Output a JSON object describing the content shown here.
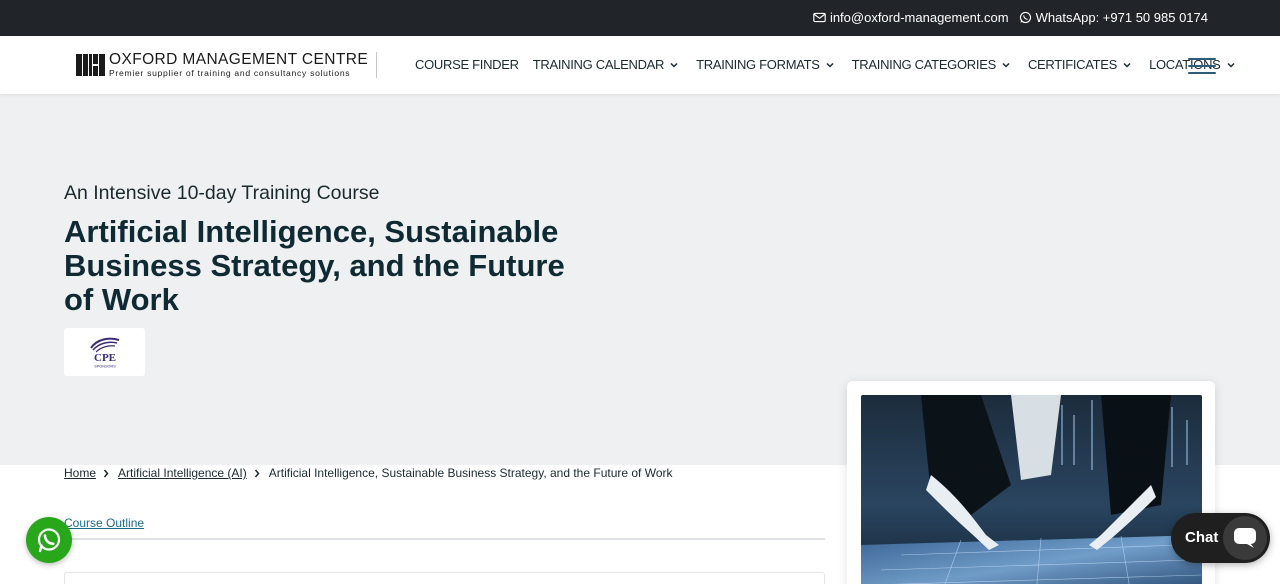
{
  "topbar": {
    "email": "info@oxford-management.com",
    "whatsapp": "WhatsApp: +971 50 985 0174"
  },
  "logo": {
    "name": "OXFORD MANAGEMENT CENTRE",
    "tagline": "Premier supplier of training and consultancy solutions"
  },
  "nav": {
    "items": [
      {
        "label": "COURSE FINDER",
        "has_dropdown": false
      },
      {
        "label": "TRAINING CALENDAR",
        "has_dropdown": true
      },
      {
        "label": "TRAINING FORMATS",
        "has_dropdown": true
      },
      {
        "label": "TRAINING CATEGORIES",
        "has_dropdown": true
      },
      {
        "label": "CERTIFICATES",
        "has_dropdown": true
      },
      {
        "label": "LOCATIONS",
        "has_dropdown": true
      }
    ],
    "menu_icon": "hamburger-icon"
  },
  "hero": {
    "subtitle": "An Intensive 10-day Training Course",
    "title": "Artificial Intelligence, Sustainable Business Strategy, and the Future of Work",
    "badge": {
      "text": "CPE",
      "subtext": "SPONSORS"
    }
  },
  "breadcrumb": {
    "items": [
      "Home",
      "Artificial Intelligence (AI)",
      "Artificial Intelligence, Sustainable Business Strategy, and the Future of Work"
    ]
  },
  "tabs": {
    "course_outline": "Course Outline"
  },
  "chat": {
    "label": "Chat"
  },
  "colors": {
    "topbar": "#212529",
    "hero_bg": "#eef0f1",
    "accent": "#2d5b7a",
    "whatsapp": "#29a71a",
    "chat_widget": "#1f1f1f",
    "cpe_purple": "#3b2a7a"
  }
}
